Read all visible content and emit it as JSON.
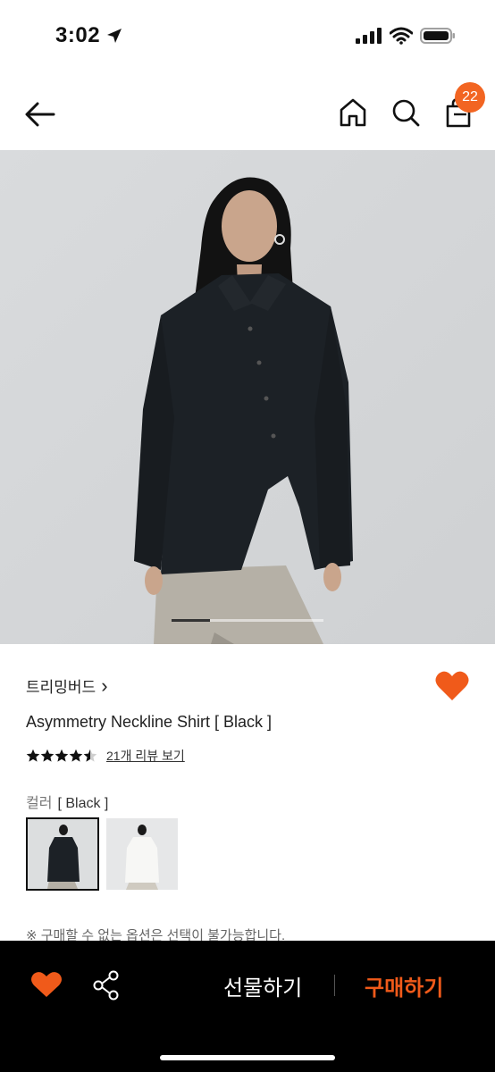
{
  "status_bar": {
    "time": "3:02"
  },
  "nav": {
    "cart_count": "22"
  },
  "brand": {
    "name": "트리밍버드",
    "chevron": "›"
  },
  "product": {
    "name": "Asymmetry Neckline Shirt [ Black ]",
    "rating": 4.5,
    "review_link": "21개 리뷰 보기"
  },
  "options": {
    "label": "컬러",
    "selected_value": "[ Black ]",
    "swatches": [
      {
        "color": "Black",
        "selected": true
      },
      {
        "color": "White",
        "selected": false
      }
    ]
  },
  "notice": "※ 구매할 수 없는 옵션은 선택이 불가능합니다.",
  "bottom_bar": {
    "gift_label": "선물하기",
    "buy_label": "구매하기"
  },
  "colors": {
    "accent": "#f05a1a",
    "badge": "#f26522",
    "bottom_bar_bg": "#000000"
  },
  "carousel": {
    "current_index": 1,
    "total": 4
  }
}
